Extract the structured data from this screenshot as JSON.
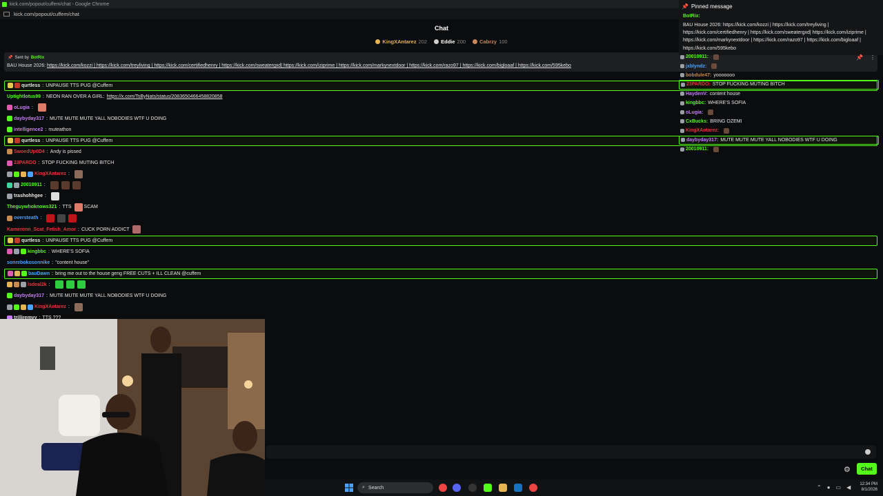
{
  "browser": {
    "title": "kick.com/popout/cuffem/chat - Google Chrome",
    "url": "kick.com/popout/cuffem/chat"
  },
  "header": {
    "title": "Chat"
  },
  "gifters": [
    {
      "name": "KingXAntarez",
      "count": "202",
      "color": "#e6b450"
    },
    {
      "name": "Eddie",
      "count": "200",
      "color": "#cfcfcf"
    },
    {
      "name": "Cabrzy",
      "count": "100",
      "color": "#c9885a"
    }
  ],
  "pinned_bar": {
    "sent_by": "Sent by",
    "bot": "BotRix",
    "prefix": "BAU House 2026:",
    "links": "https://kick.com/kozzi | https://kick.com/treyliving | https://kick.com/certifiedhenry | https://kick.com/sweatergxd| https://kick.com/iziprime | https://kick.com/markynextdoor | https://kick.com/razo97 | https://kick.com/bigloaaf | https://kick.com/595kebo"
  },
  "messages": [
    {
      "user": "qurtless",
      "color": "#e6e6e6",
      "text": "UNPAUSE TTS PUG @Cuffem",
      "hl": true,
      "badges": [
        "#e6c84a",
        "#c0392b"
      ]
    },
    {
      "user": "Uptightlotus99",
      "color": "#53fc18",
      "text": "NEON RAN OVER A GIRL:",
      "link": "https://x.com/TsByNats/status/2083650466458820858",
      "badges": []
    },
    {
      "user": "oLugia",
      "color": "#c77dff",
      "text": "",
      "emotes": [
        "#e07b6a"
      ],
      "badges": [
        "#e05ab0"
      ]
    },
    {
      "user": "daybyday317",
      "color": "#c77dff",
      "text": "MUTE MUTE MUTE YALL NOBODIES WTF U DOING",
      "badges": [
        "#53fc18"
      ]
    },
    {
      "user": "intelligence2",
      "color": "#c77dff",
      "text": "muteathon",
      "badges": [
        "#53fc18"
      ]
    },
    {
      "user": "qurtless",
      "color": "#e6e6e6",
      "text": "UNPAUSE TTS PUG @Cuffem",
      "hl": true,
      "badges": [
        "#e6c84a",
        "#c0392b"
      ]
    },
    {
      "user": "SwoedUp0D4",
      "color": "#e0393e",
      "text": "Andy is pissed",
      "badges": [
        "#c98a4b"
      ]
    },
    {
      "user": "23PARDO",
      "color": "#e0393e",
      "text": "STOP FUCKING MUTING BITCH",
      "badges": [
        "#e05ab0"
      ]
    },
    {
      "user": "KingXAntarez",
      "color": "#e0393e",
      "text": "",
      "emotes": [
        "#8b6b5a"
      ],
      "badges": [
        "#9aa0a6",
        "#53fc18",
        "#e6b450",
        "#4aa3ff"
      ]
    },
    {
      "user": "20010911",
      "color": "#53fc18",
      "text": "",
      "emotes": [
        "#5a3a2a",
        "#5a3a2a",
        "#5a3a2a"
      ],
      "badges": [
        "#3ad6a0",
        "#9aa0a6"
      ]
    },
    {
      "user": "trashohhgee",
      "color": "#e6e6e6",
      "text": "",
      "emotes": [
        "#dddddd"
      ],
      "badges": [
        "#9aa0a6"
      ]
    },
    {
      "user": "Theguywhoknows321",
      "color": "#53fc18",
      "text": "TTS",
      "extra": "SCAM",
      "emotes": [
        "#e07b6a"
      ],
      "badges": []
    },
    {
      "user": "oversteath",
      "color": "#4aa3ff",
      "text": "",
      "emotes": [
        "#c0141a",
        "#444444",
        "#c0141a"
      ],
      "badges": [
        "#c98a4b"
      ]
    },
    {
      "user": "Kameronn_Scat_Fetish_Amor",
      "color": "#e0393e",
      "text": "CUCK PORN ADDICT",
      "emotes": [
        "#b06a6a"
      ],
      "badges": []
    },
    {
      "user": "qurtless",
      "color": "#e6e6e6",
      "text": "UNPAUSE TTS PUG @Cuffem",
      "hl": true,
      "badges": [
        "#e6c84a",
        "#c0392b"
      ]
    },
    {
      "user": "kingbbc",
      "color": "#53fc18",
      "text": "WHERE'S SOFIA",
      "badges": [
        "#e05ab0",
        "#9aa0a6",
        "#53fc18"
      ]
    },
    {
      "user": "sonrebokosonnike",
      "color": "#4aa3ff",
      "text": "\"content house\"",
      "badges": []
    },
    {
      "user": "bauDawn",
      "color": "#4aa3ff",
      "text": "bring me out to the house geng FREE CUTS + ILL CLEAN @cuffem",
      "hl": true,
      "badges": [
        "#e05ab0",
        "#e6b450",
        "#53fc18"
      ]
    },
    {
      "user": "lsdeal2k",
      "color": "#e0393e",
      "text": "",
      "emotes": [
        "#2ecc40",
        "#2ecc40",
        "#2ecc40"
      ],
      "badges": [
        "#e6b450",
        "#c98a4b",
        "#9aa0a6"
      ]
    },
    {
      "user": "daybyday317",
      "color": "#c77dff",
      "text": "MUTE MUTE MUTE YALL NOBODIES WTF U DOING",
      "badges": [
        "#53fc18"
      ]
    },
    {
      "user": "KingXAntarez",
      "color": "#e0393e",
      "text": "",
      "emotes": [
        "#8b6b5a"
      ],
      "badges": [
        "#9aa0a6",
        "#53fc18",
        "#e6b450",
        "#4aa3ff"
      ]
    },
    {
      "user": "trilliremvy",
      "color": "#e6e6e6",
      "text": "TTS ???",
      "badges": [
        "#c77dff"
      ]
    }
  ],
  "right_panel": {
    "pinned_title": "Pinned message",
    "bot": "BotRix:",
    "body": "BAU House 2026: https://kick.com/kozzi | https://kick.com/treyliving | https://kick.com/certifiedhenry | https://kick.com/sweatergxd| https://kick.com/iziprime | https://kick.com/markynextdoor | https://kick.com/razo97 | https://kick.com/bigloaaf | https://kick.com/595kebo",
    "messages": [
      {
        "user": "20010911:",
        "color": "#53fc18",
        "text": ""
      },
      {
        "user": "jxblyndz:",
        "color": "#4aa3ff",
        "text": ""
      },
      {
        "user": "bobdule47:",
        "color": "#c98a4b",
        "text": "yooooooo"
      },
      {
        "user": "23PARDO:",
        "color": "#e0393e",
        "text": "STOP FUCKING MUTING BITCH",
        "hl": true
      },
      {
        "user": "HaydenV:",
        "color": "#c77dff",
        "text": "content house"
      },
      {
        "user": "kingbbc:",
        "color": "#53fc18",
        "text": "WHERE'S SOFIA"
      },
      {
        "user": "oLugia:",
        "color": "#c77dff",
        "text": ""
      },
      {
        "user": "CxBucks:",
        "color": "#53fc18",
        "text": "BRING OZEMI"
      },
      {
        "user": "KingXAntarez:",
        "color": "#e0393e",
        "text": ""
      },
      {
        "user": "daybyday317:",
        "color": "#c77dff",
        "text": "MUTE MUTE MUTE YALL NOBODIES WTF U DOING",
        "hl": true
      },
      {
        "user": "20010911:",
        "color": "#53fc18",
        "text": ""
      }
    ]
  },
  "input": {
    "placeholder": ""
  },
  "send_button": "Chat",
  "taskbar": {
    "search": "Search",
    "time": "12:34 PM",
    "date": "8/1/2026"
  },
  "accent": "#53fc18"
}
